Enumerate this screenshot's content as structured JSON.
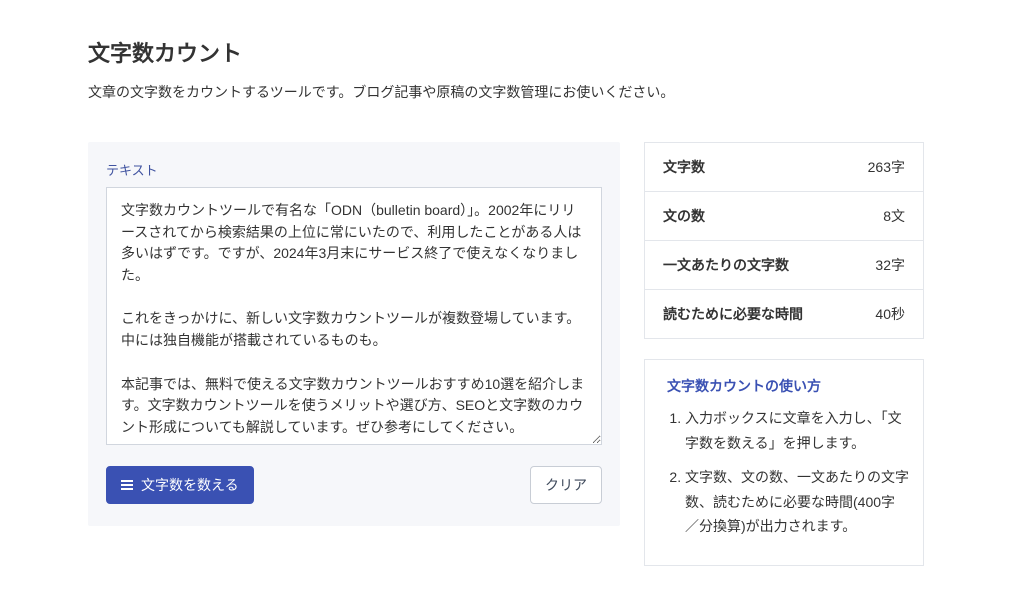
{
  "header": {
    "title": "文字数カウント",
    "subtitle": "文章の文字数をカウントするツールです。ブログ記事や原稿の文字数管理にお使いください。"
  },
  "editor": {
    "label": "テキスト",
    "value": "文字数カウントツールで有名な「ODN（bulletin board）」。2002年にリリースされてから検索結果の上位に常にいたので、利用したことがある人は多いはずです。ですが、2024年3月末にサービス終了で使えなくなりました。\n\nこれをきっかけに、新しい文字数カウントツールが複数登場しています。中には独自機能が搭載されているものも。\n\n本記事では、無料で使える文字数カウントツールおすすめ10選を紹介します。文字数カウントツールを使うメリットや選び方、SEOと文字数のカウント形成についても解説しています。ぜひ参考にしてください。"
  },
  "buttons": {
    "count_label": "文字数を数える",
    "clear_label": "クリア"
  },
  "stats": {
    "char_count": {
      "label": "文字数",
      "value": "263字"
    },
    "sentence_count": {
      "label": "文の数",
      "value": "8文"
    },
    "chars_per_sentence": {
      "label": "一文あたりの文字数",
      "value": "32字"
    },
    "read_time": {
      "label": "読むために必要な時間",
      "value": "40秒"
    }
  },
  "howto": {
    "title": "文字数カウントの使い方",
    "steps": [
      "入力ボックスに文章を入力し、「文字数を数える」を押します。",
      "文字数、文の数、一文あたりの文字数、読むために必要な時間(400字／分換算)が出力されます。"
    ]
  }
}
